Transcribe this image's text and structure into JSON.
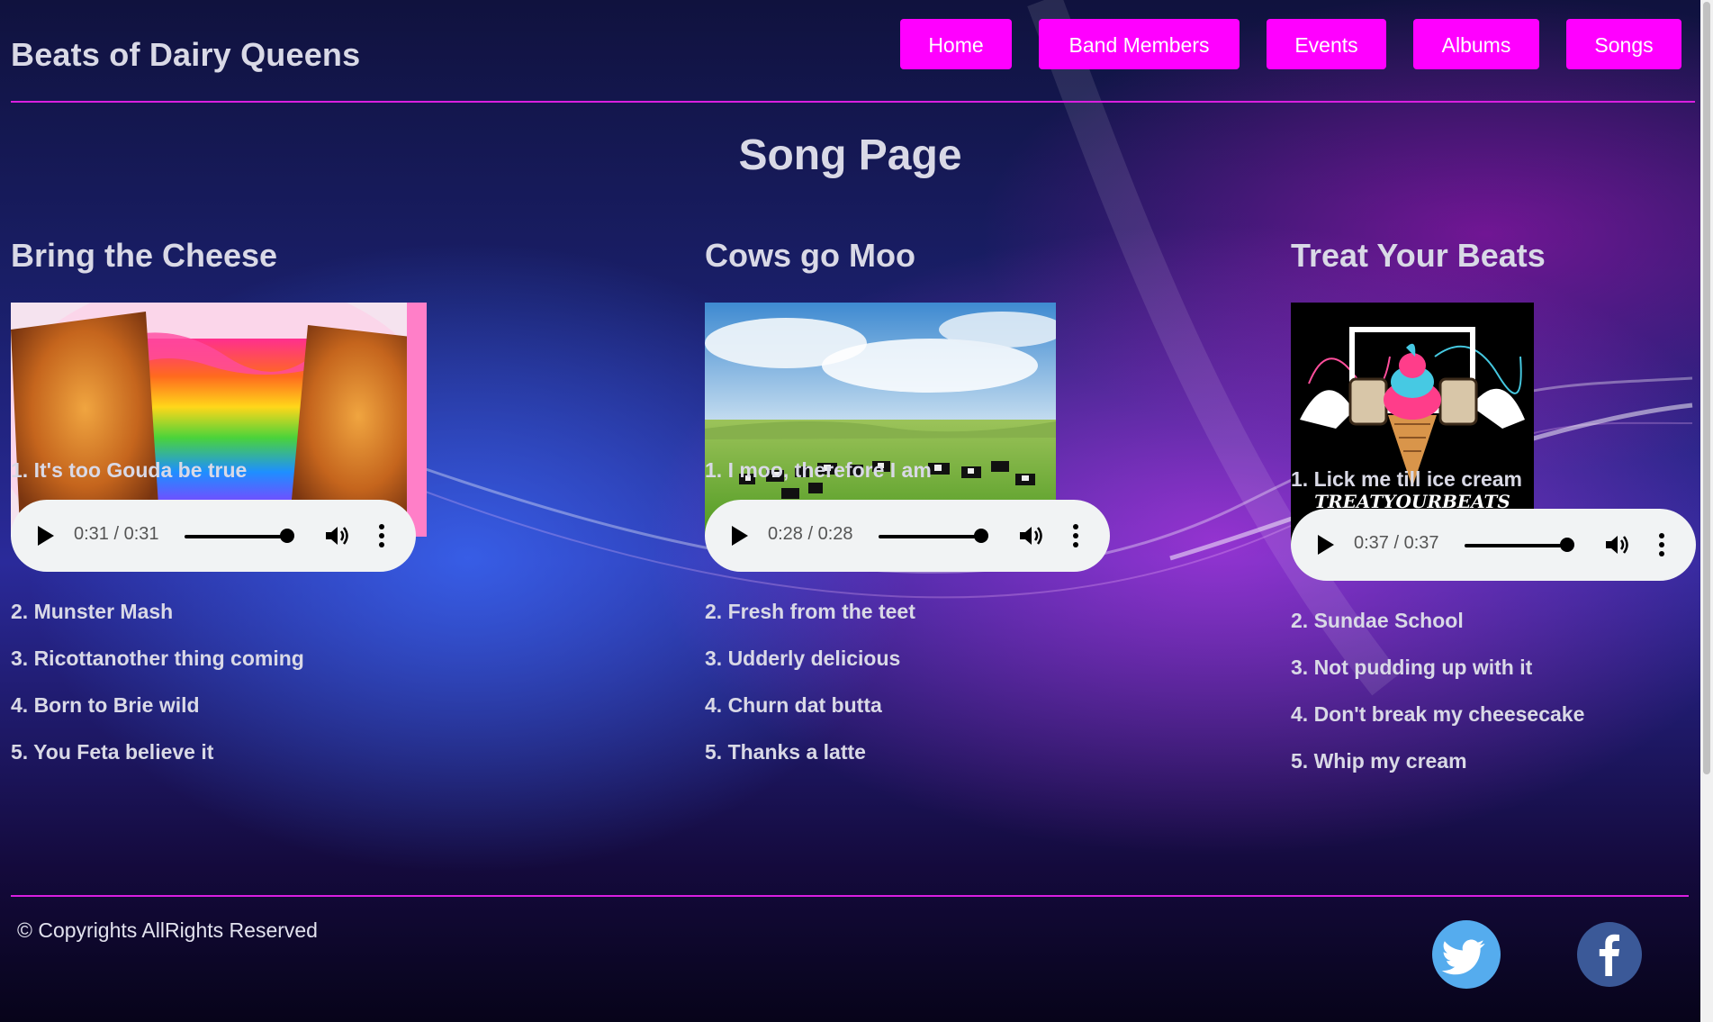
{
  "header": {
    "brand": "Beats of Dairy Queens",
    "nav": [
      {
        "label": "Home"
      },
      {
        "label": "Band Members"
      },
      {
        "label": "Events"
      },
      {
        "label": "Albums"
      },
      {
        "label": "Songs"
      }
    ],
    "accent_color": "#ff00ff"
  },
  "main": {
    "page_title": "Song Page",
    "albums": [
      {
        "title": "Bring the Cheese",
        "image": "rainbow-grilled-cheese",
        "songs": [
          "1. It's too Gouda be true",
          "2. Munster Mash",
          "3. Ricottanother thing coming",
          "4. Born to Brie wild",
          "5. You Feta believe it"
        ],
        "player": {
          "time": "0:31 / 0:31",
          "progress": 1.0
        }
      },
      {
        "title": "Cows go Moo",
        "image": "cows-in-field",
        "songs": [
          "1. I moo, therefore I am",
          "2. Fresh from the teet",
          "3. Udderly delicious",
          "4. Churn dat butta",
          "5. Thanks a latte"
        ],
        "player": {
          "time": "0:28 / 0:28",
          "progress": 1.0
        }
      },
      {
        "title": "Treat Your Beats",
        "image": "treat-your-beats-logo",
        "logo_text": "TREATYOURBEATS",
        "songs": [
          "1. Lick me till ice cream",
          "2. Sundae School",
          "3. Not pudding up with it",
          "4. Don't break my cheesecake",
          "5. Whip my cream"
        ],
        "player": {
          "time": "0:37 / 0:37",
          "progress": 1.0
        }
      }
    ]
  },
  "footer": {
    "copyright": "© Copyrights AllRights Reserved",
    "social": [
      {
        "icon": "twitter-icon",
        "color": "#55acee"
      },
      {
        "icon": "facebook-icon",
        "color": "#3b5998"
      }
    ]
  }
}
